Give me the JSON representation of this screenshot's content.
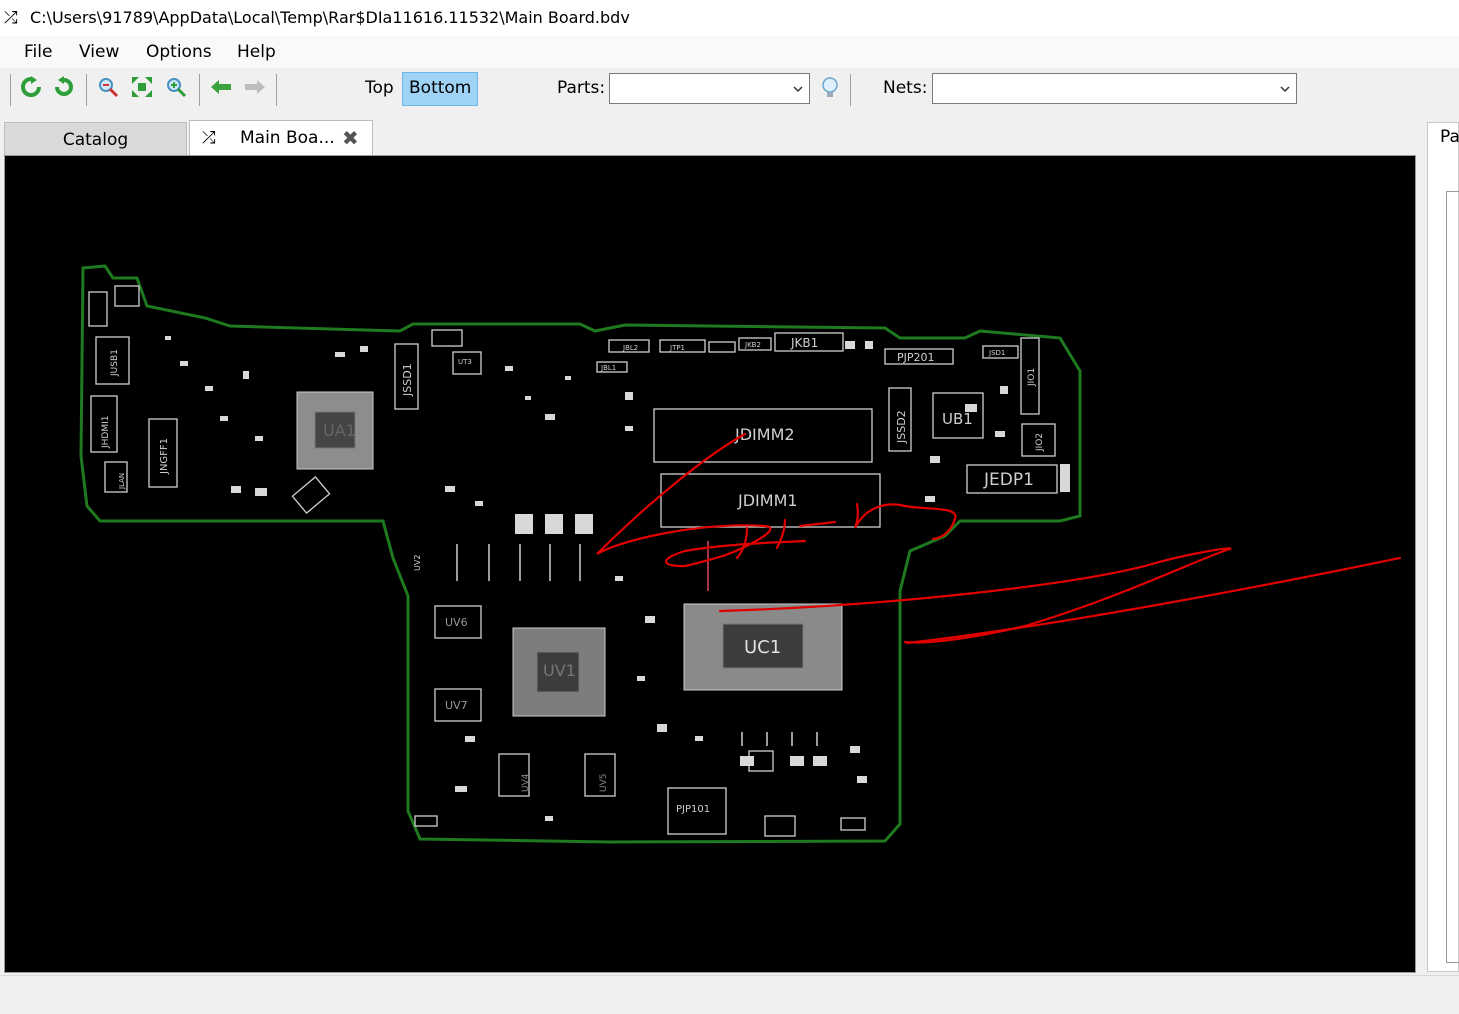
{
  "window": {
    "title": "C:\\Users\\91789\\AppData\\Local\\Temp\\Rar$DIa11616.11532\\Main Board.bdv",
    "icon": "shuffle-icon"
  },
  "menu": [
    {
      "label": "File"
    },
    {
      "label": "View"
    },
    {
      "label": "Options"
    },
    {
      "label": "Help"
    }
  ],
  "toolbar": {
    "icons": [
      "refresh-icon",
      "rotate-icon",
      "zoom-in-icon",
      "fit-icon",
      "zoom-out-icon",
      "back-arrow-icon",
      "forward-arrow-icon",
      "lightbulb-icon"
    ],
    "side_top": "Top",
    "side_bottom": "Bottom",
    "active_side": "Bottom",
    "parts_label": "Parts:",
    "parts_value": "",
    "nets_label": "Nets:",
    "nets_value": ""
  },
  "tabs": [
    {
      "label": "Catalog",
      "active": false
    },
    {
      "label": "Main Boa...",
      "active": true,
      "icon": "shuffle-icon",
      "close_icon": "close-icon"
    }
  ],
  "right_panel": {
    "tab_label": "Pa"
  },
  "board": {
    "outline_color": "#1f7a1f",
    "background_color": "#000000",
    "annotation_color": "#e00000",
    "labels": {
      "jdimm2": "JDIMM2",
      "jdimm1": "JDIMM1",
      "uc1": "UC1",
      "ub1": "UB1",
      "jedp1": "JEDP1",
      "jkb1": "JKB1",
      "pjp201": "PJP201",
      "pjp101": "PJP101",
      "jssd1": "JSSD1",
      "jssd2": "JSSD2",
      "jusb1": "JUSB1",
      "jhdmi1": "JHDMI1",
      "jngff1": "JNGFF1",
      "uv6": "UV6",
      "uv7": "UV7",
      "uv1": "UV1",
      "uv4": "UV4",
      "uv5": "UV5",
      "jio1": "JIO1",
      "jio2": "JIO2",
      "jbl2": "JBL2",
      "jtp1": "JTP1",
      "jkb2": "JKB2",
      "jbl1": "JBL1",
      "ut3": "UT3",
      "ua1": "UA1",
      "uv2": "UV2",
      "jlan": "JLAN",
      "jsd1": "JSD1"
    }
  }
}
